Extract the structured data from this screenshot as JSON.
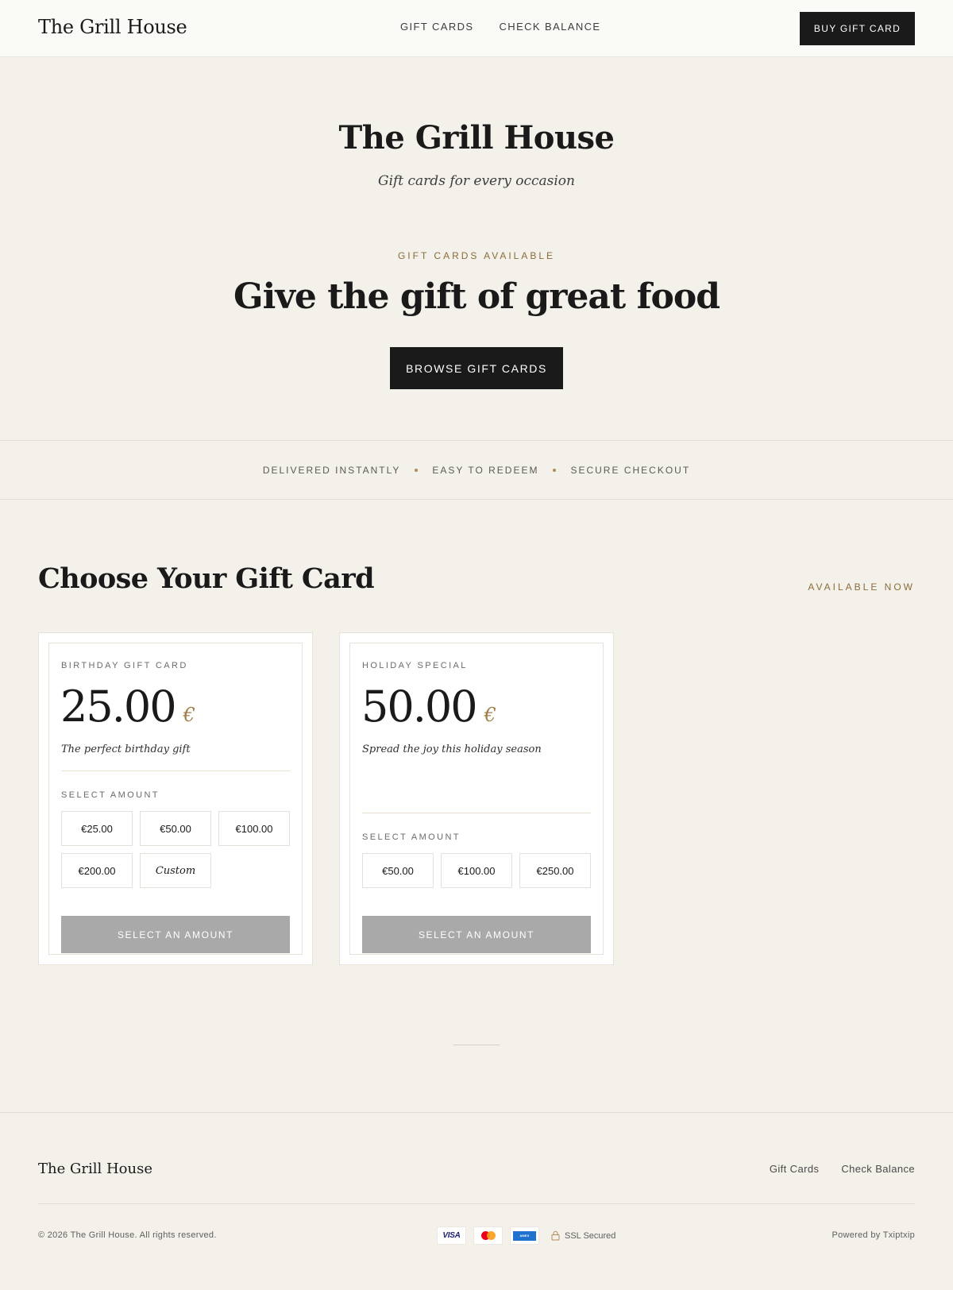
{
  "header": {
    "brand": "The Grill House",
    "nav": [
      "GIFT CARDS",
      "CHECK BALANCE"
    ],
    "buy_button": "BUY GIFT CARD"
  },
  "hero": {
    "title": "The Grill House",
    "subtitle": "Gift cards for every occasion",
    "eyebrow": "GIFT CARDS AVAILABLE",
    "headline": "Give the gift of great food",
    "cta": "BROWSE GIFT CARDS"
  },
  "features": [
    "DELIVERED INSTANTLY",
    "EASY TO REDEEM",
    "SECURE CHECKOUT"
  ],
  "section": {
    "title": "Choose Your Gift Card",
    "tag": "AVAILABLE NOW"
  },
  "cards": [
    {
      "label": "BIRTHDAY GIFT CARD",
      "price": "25.00",
      "currency": "€",
      "description": "The perfect birthday gift",
      "select_label": "SELECT AMOUNT",
      "options": [
        "€25.00",
        "€50.00",
        "€100.00",
        "€200.00",
        "Custom"
      ],
      "cta": "SELECT AN AMOUNT"
    },
    {
      "label": "HOLIDAY SPECIAL",
      "price": "50.00",
      "currency": "€",
      "description": "Spread the joy this holiday season",
      "select_label": "SELECT AMOUNT",
      "options": [
        "€50.00",
        "€100.00",
        "€250.00"
      ],
      "cta": "SELECT AN AMOUNT"
    }
  ],
  "footer": {
    "brand": "The Grill House",
    "links": [
      "Gift Cards",
      "Check Balance"
    ],
    "copyright": "© 2026 The Grill House. All rights reserved.",
    "payments": {
      "visa": "VISA",
      "mastercard": "mastercard-icon",
      "amex": "AMEX"
    },
    "ssl": "SSL Secured",
    "powered": "Powered by Txiptxip"
  },
  "colors": {
    "background": "#f4f0ea",
    "header_bg": "#fafaf7",
    "dark": "#1a1a1a",
    "accent_gold": "#8a6d3b",
    "disabled_button": "#a9a9a9"
  }
}
